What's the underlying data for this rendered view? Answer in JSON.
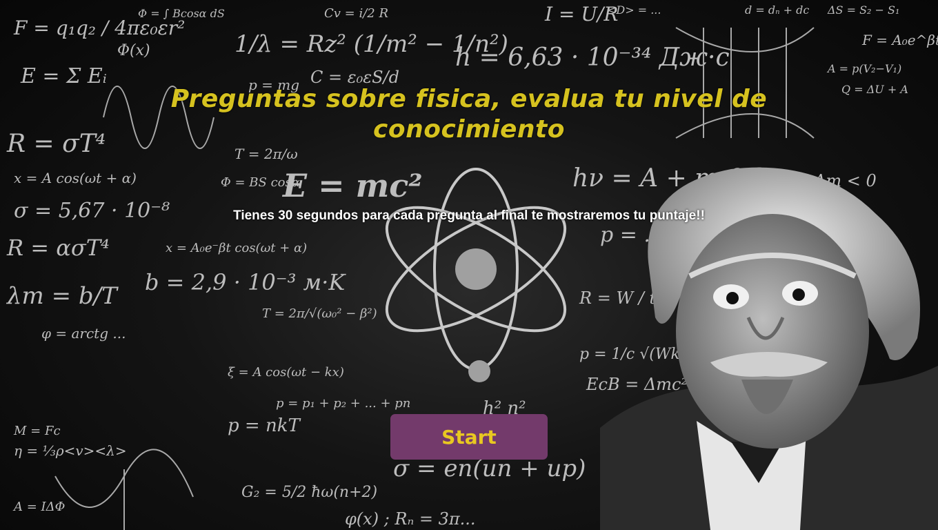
{
  "page": {
    "title": "Preguntas sobre fisica, evalua tu nivel de conocimiento",
    "subtitle": "Tienes 30 segundos para cada pregunta al final te mostraremos tu puntaje!!",
    "start_label": "Start"
  },
  "colors": {
    "title": "#d6c21f",
    "button_bg": "#733a6b",
    "button_text": "#e8c821",
    "subtitle": "#ffffff"
  },
  "background": {
    "image_description_icon": "chalkboard-formulas-background",
    "portrait_icon": "einstein-portrait-image",
    "atom_icon": "atom-illustration"
  }
}
